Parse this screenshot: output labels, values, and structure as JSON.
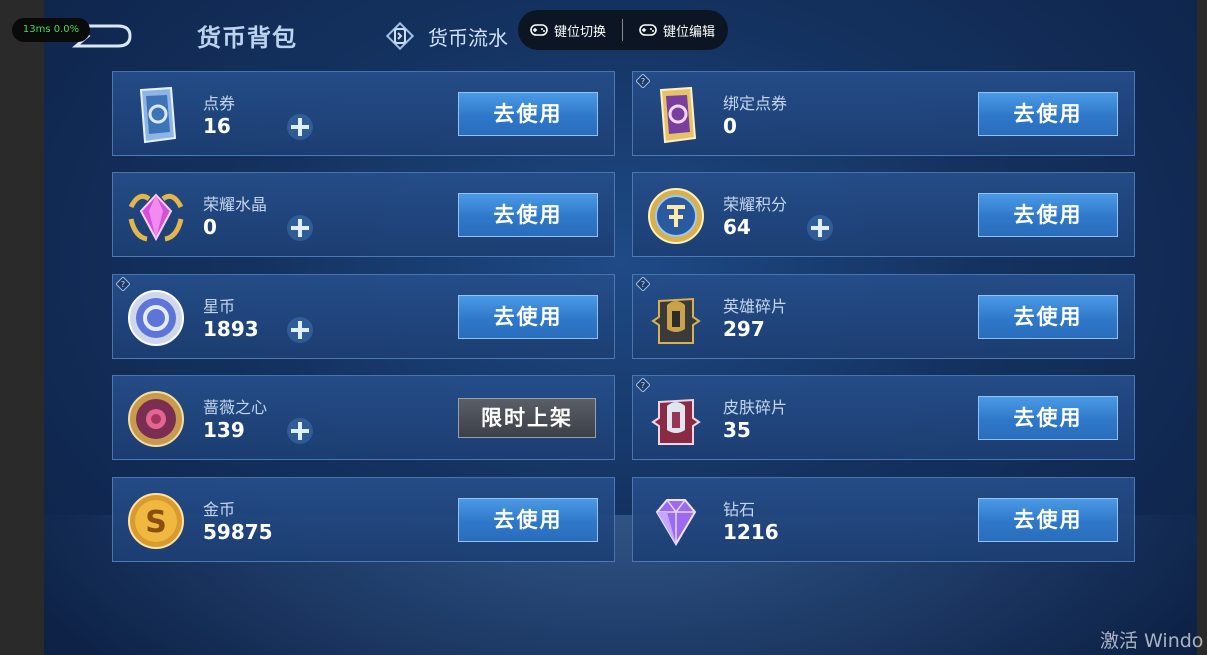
{
  "perf": {
    "text": "13ms  0.0%"
  },
  "header": {
    "title": "货币背包",
    "flow_tab": "货币流水"
  },
  "keybar": {
    "switch_label": "键位切换",
    "edit_label": "键位编辑"
  },
  "currencies": [
    {
      "name": "点券",
      "value": "16",
      "button": "去使用",
      "icon": "coupon-card-icon",
      "has_plus": true,
      "has_help": false
    },
    {
      "name": "绑定点券",
      "value": "0",
      "button": "去使用",
      "icon": "bound-coupon-card-icon",
      "has_plus": false,
      "has_help": true
    },
    {
      "name": "荣耀水晶",
      "value": "0",
      "button": "去使用",
      "icon": "glory-crystal-icon",
      "has_plus": true,
      "has_help": false
    },
    {
      "name": "荣耀积分",
      "value": "64",
      "button": "去使用",
      "icon": "glory-points-icon",
      "has_plus": true,
      "has_help": false
    },
    {
      "name": "星币",
      "value": "1893",
      "button": "去使用",
      "icon": "star-coin-icon",
      "has_plus": true,
      "has_help": true
    },
    {
      "name": "英雄碎片",
      "value": "297",
      "button": "去使用",
      "icon": "hero-fragment-icon",
      "has_plus": false,
      "has_help": true
    },
    {
      "name": "蔷薇之心",
      "value": "139",
      "button": "限时上架",
      "icon": "rose-heart-icon",
      "has_plus": true,
      "has_help": false
    },
    {
      "name": "皮肤碎片",
      "value": "35",
      "button": "去使用",
      "icon": "skin-fragment-icon",
      "has_plus": false,
      "has_help": true
    },
    {
      "name": "金币",
      "value": "59875",
      "button": "去使用",
      "icon": "gold-coin-icon",
      "has_plus": false,
      "has_help": false
    },
    {
      "name": "钻石",
      "value": "1216",
      "button": "去使用",
      "icon": "diamond-icon",
      "has_plus": false,
      "has_help": false
    }
  ],
  "watermark": {
    "text": "激活 Windo"
  },
  "colors": {
    "accent": "#2f78c9",
    "panel": "#1c3e73",
    "gray_button": "#3c4048"
  }
}
